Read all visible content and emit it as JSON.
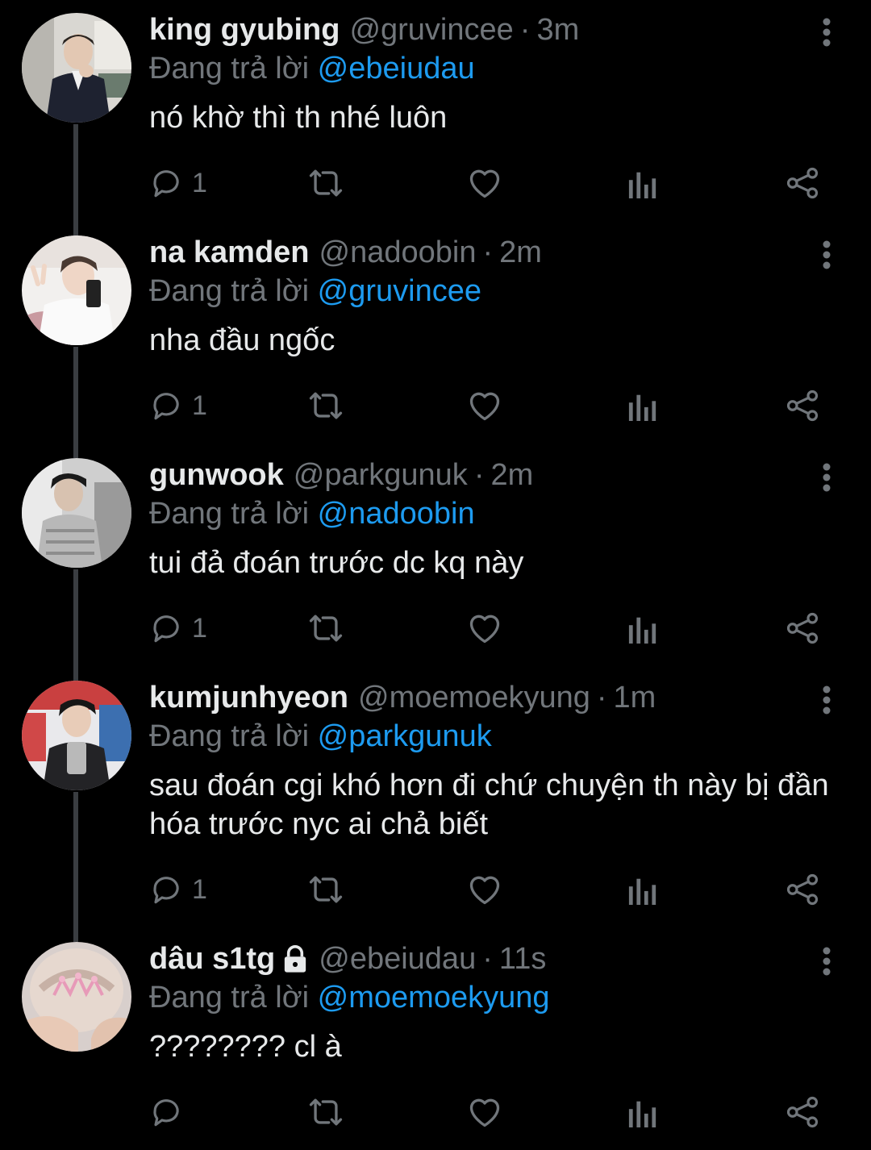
{
  "colors": {
    "background": "#000000",
    "text_primary": "#e7e9ea",
    "text_secondary": "#71767b",
    "mention": "#1d9bf0",
    "thread_line": "#3a3d41"
  },
  "reply_prefix": "Đang trả lời",
  "tweets": [
    {
      "name": "king gyubing",
      "handle": "@gruvincee",
      "time": "3m",
      "reply_to": "@ebeiudau",
      "text": "nó khờ thì th nhé luôn",
      "reply_count": "1",
      "locked": false
    },
    {
      "name": "na kamden",
      "handle": "@nadoobin",
      "time": "2m",
      "reply_to": "@gruvincee",
      "text": "nha đầu ngốc",
      "reply_count": "1",
      "locked": false
    },
    {
      "name": "gunwook",
      "handle": "@parkgunuk",
      "time": "2m",
      "reply_to": "@nadoobin",
      "text": "tui đả đoán trước dc kq này",
      "reply_count": "1",
      "locked": false
    },
    {
      "name": "kumjunhyeon",
      "handle": "@moemoekyung",
      "time": "1m",
      "reply_to": "@parkgunuk",
      "text": "sau đoán cgi khó hơn đi chứ chuyện th này bị đần hóa trước nyc ai chả biết",
      "reply_count": "1",
      "locked": false
    },
    {
      "name": "dâu s1tg",
      "handle": "@ebeiudau",
      "time": "11s",
      "reply_to": "@moemoekyung",
      "text": "???????? cl à",
      "reply_count": "",
      "locked": true
    }
  ],
  "icons": {
    "reply": "reply-icon",
    "retweet": "retweet-icon",
    "like": "heart-icon",
    "views": "views-icon",
    "share": "share-icon",
    "more": "more-vertical-icon",
    "lock": "lock-icon"
  },
  "separator": "·"
}
